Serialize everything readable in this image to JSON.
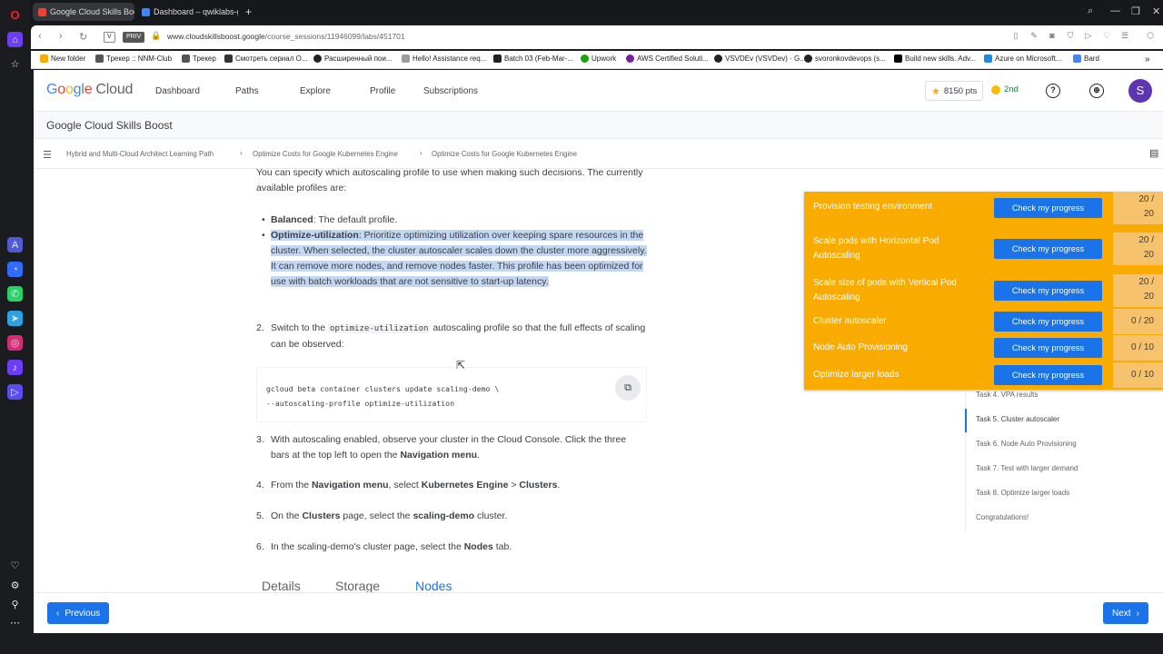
{
  "browser": {
    "tabs": [
      {
        "title": "Google Cloud Skills Boost",
        "active": true,
        "color": "#ea4335"
      },
      {
        "title": "Dashboard – qwiklabs-gc",
        "active": false,
        "color": "#4285f4"
      }
    ],
    "new_tab_symbol": "+",
    "address": {
      "private_chip": "PRIV",
      "v_chip": "V",
      "url_domain": "www.cloudskillsboost.google",
      "url_path": "/course_sessions/11946099/labs/451701"
    },
    "bookmarks": [
      {
        "label": "New folder",
        "color": "#f9ab00"
      },
      {
        "label": "Трекер :: NNM-Club",
        "color": "#555555"
      },
      {
        "label": "Трекер",
        "color": "#555555"
      },
      {
        "label": "Смотреть сериал О...",
        "color": "#333333"
      },
      {
        "label": "Расширенный пои...",
        "color": "#222222"
      },
      {
        "label": "Hello! Assistance req...",
        "color": "#9e9e9e"
      },
      {
        "label": "Batch 03 (Feb-Mar-...",
        "color": "#222222"
      },
      {
        "label": "Upwork",
        "color": "#14a800"
      },
      {
        "label": "AWS Certified Soluti...",
        "color": "#7b1fa2"
      },
      {
        "label": "VSVDEv (VSVDev) · G...",
        "color": "#222222"
      },
      {
        "label": "svoronkovdevops (s...",
        "color": "#222222"
      },
      {
        "label": "Build new skills. Adv...",
        "color": "#000000"
      },
      {
        "label": "Azure on Microsoft...",
        "color": "#1e88e5"
      },
      {
        "label": "Bard",
        "color": "#4285f4"
      }
    ]
  },
  "header": {
    "logo_google": [
      "G",
      "o",
      "o",
      "g",
      "l",
      "e"
    ],
    "logo_cloud": "Cloud",
    "nav": [
      "Dashboard",
      "Paths",
      "Explore",
      "Profile",
      "Subscriptions"
    ],
    "points": "8150 pts",
    "rank": "2nd",
    "avatar_letter": "S"
  },
  "site_title": "Google Cloud Skills Boost",
  "breadcrumbs": [
    "Hybrid and Multi-Cloud Architect Learning Path",
    "Optimize Costs for Google Kubernetes Engine",
    "Optimize Costs for Google Kubernetes Engine"
  ],
  "content": {
    "intro": "You can specify which autoscaling profile to use when making such decisions. The currently available profiles are:",
    "profiles": [
      {
        "name": "Balanced",
        "desc": ": The default profile."
      },
      {
        "name": "Optimize-utilization",
        "desc": ": Prioritize optimizing utilization over keeping spare resources in the cluster. When selected, the cluster autoscaler scales down the cluster more aggressively. It can remove more nodes, and remove nodes faster. This profile has been optimized for use with batch workloads that are not sensitive to start-up latency."
      }
    ],
    "step2_num": "2.",
    "step2_a": "Switch to the ",
    "step2_code": "optimize-utilization",
    "step2_b": " autoscaling profile so that the full effects of scaling can be observed:",
    "code_line1": "gcloud beta container clusters update scaling-demo \\",
    "code_line2": "--autoscaling-profile optimize-utilization",
    "step3_num": "3.",
    "step3_a": "With autoscaling enabled, observe your cluster in the Cloud Console. Click the three bars at the top left to open the ",
    "step3_b": "Navigation menu",
    "step3_c": ".",
    "step4_num": "4.",
    "step4_a": "From the ",
    "step4_b": "Navigation menu",
    "step4_c": ", select ",
    "step4_d": "Kubernetes Engine",
    "step4_e": " > ",
    "step4_f": "Clusters",
    "step4_g": ".",
    "step5_num": "5.",
    "step5_a": "On the ",
    "step5_b": "Clusters",
    "step5_c": " page, select the ",
    "step5_d": "scaling-demo",
    "step5_e": " cluster.",
    "step6_num": "6.",
    "step6_a": "In the scaling-demo's cluster page, select the ",
    "step6_b": "Nodes",
    "step6_c": " tab.",
    "subtabs": [
      "Details",
      "Storage",
      "Nodes"
    ]
  },
  "progress": {
    "button_label": "Check my progress",
    "rows": [
      {
        "name": "Provision testing environment",
        "score_top": "20 /",
        "score_bottom": "20"
      },
      {
        "name": "Scale pods with Horizontal Pod Autoscaling",
        "score_top": "20 /",
        "score_bottom": "20"
      },
      {
        "name": "Scale size of pods with Vertical Pod Autoscaling",
        "score_top": "20 /",
        "score_bottom": "20"
      },
      {
        "name": "Cluster autoscaler",
        "score_top": "0 / 20",
        "score_bottom": ""
      },
      {
        "name": "Node Auto Provisioning",
        "score_top": "0 / 10",
        "score_bottom": ""
      },
      {
        "name": "Optimize larger loads",
        "score_top": "0 / 10",
        "score_bottom": ""
      }
    ]
  },
  "tasks": [
    {
      "label": "Task 4. VPA results",
      "active": false
    },
    {
      "label": "Task 5. Cluster autoscaler",
      "active": true
    },
    {
      "label": "Task 6. Node Auto Provisioning",
      "active": false
    },
    {
      "label": "Task 7. Test with larger demand",
      "active": false
    },
    {
      "label": "Task 8. Optimize larger loads",
      "active": false
    },
    {
      "label": "Congratulations!",
      "active": false
    }
  ],
  "footer": {
    "previous": "Previous",
    "next": "Next"
  },
  "colors": {
    "accent": "#1a73e8",
    "progress_bg": "#f9ab00",
    "highlight": "#c2d7f4"
  }
}
